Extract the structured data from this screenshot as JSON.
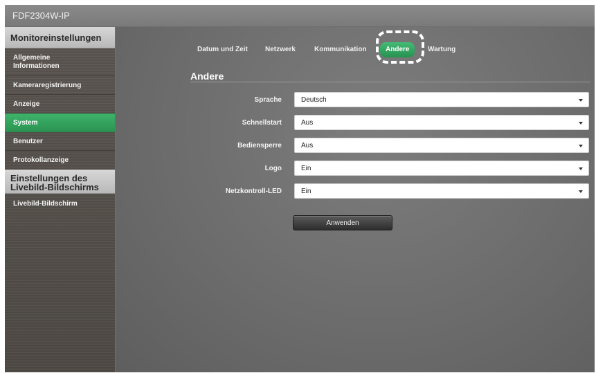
{
  "app": {
    "title": "FDF2304W-IP"
  },
  "sidebar": {
    "section1": "Monitoreinstellungen",
    "items": [
      {
        "label": "Allgemeine Informationen"
      },
      {
        "label": "Kameraregistrierung"
      },
      {
        "label": "Anzeige"
      },
      {
        "label": "System",
        "active": true
      },
      {
        "label": "Benutzer"
      },
      {
        "label": "Protokollanzeige"
      }
    ],
    "section2": "Einstellungen des Livebild-Bildschirms",
    "live_item": "Livebild-Bildschirm"
  },
  "tabs": [
    {
      "label": "Datum und Zeit"
    },
    {
      "label": "Netzwerk"
    },
    {
      "label": "Kommunikation"
    },
    {
      "label": "Andere",
      "active": true
    },
    {
      "label": "Wartung"
    }
  ],
  "section": {
    "title": "Andere"
  },
  "settings": [
    {
      "label": "Sprache",
      "value": "Deutsch"
    },
    {
      "label": "Schnellstart",
      "value": "Aus"
    },
    {
      "label": "Bediensperre",
      "value": "Aus"
    },
    {
      "label": "Logo",
      "value": "Ein"
    },
    {
      "label": "Netzkontroll-LED",
      "value": "Ein"
    }
  ],
  "apply_button": "Anwenden",
  "colors": {
    "accent_green": "#2fa35c",
    "highlight": "#ffffff",
    "sidebar_dark": "#524d48",
    "content_gray": "#737373"
  },
  "icons": {
    "dropdown": "chevron-down-icon"
  }
}
